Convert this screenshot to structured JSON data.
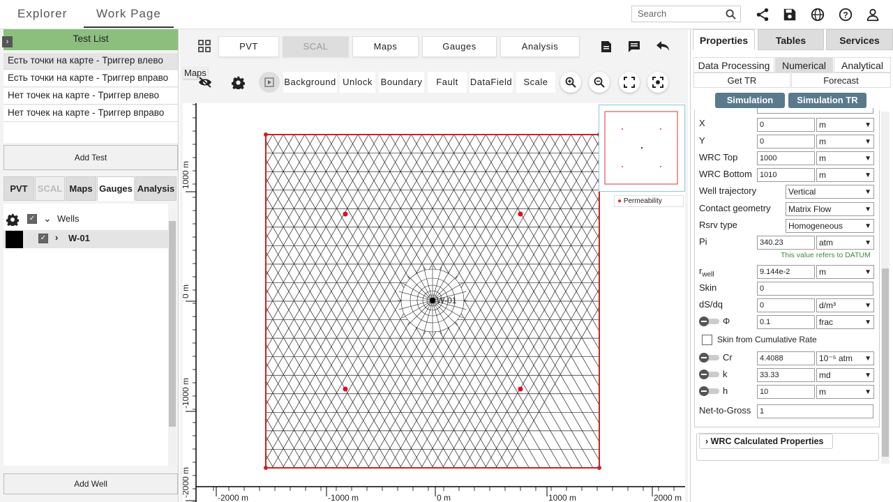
{
  "top": {
    "tabs": [
      "Explorer",
      "Work Page"
    ],
    "search_placeholder": "Search",
    "icons": [
      "share-icon",
      "save-icon",
      "globe-icon",
      "help-icon",
      "user-icon"
    ]
  },
  "left": {
    "test_list_title": "Test List",
    "tests": [
      "Есть точки на карте - Триггер влево",
      "Есть точки на карте - Триггер вправо",
      "Нет точек на карте - Триггер влево",
      "Нет точек на карте - Триггер вправо"
    ],
    "add_test": "Add Test",
    "tabs": [
      "PVT",
      "SCAL",
      "Maps",
      "Gauges",
      "Analysis"
    ],
    "wells_label": "Wells",
    "well_name": "W-01",
    "add_well": "Add Well"
  },
  "center": {
    "top_buttons": [
      "PVT",
      "SCAL",
      "Maps",
      "Gauges",
      "Analysis"
    ],
    "maps_label": "Maps",
    "tools": [
      "Background",
      "Unlock",
      "Boundary",
      "Fault",
      "DataField",
      "Scale"
    ],
    "well_label": "W-01",
    "legend": "Permeability",
    "x_ticks": [
      "-2000 m",
      "-1000 m",
      "0 m",
      "1000 m",
      "2000 m"
    ],
    "y_ticks": [
      "1000 m",
      "0 m",
      "-1000 m",
      "-2000 m"
    ]
  },
  "right": {
    "tabs": [
      "Properties",
      "Tables",
      "Services"
    ],
    "sub_tabs": [
      "Data Processing",
      "Numerical",
      "Analytical"
    ],
    "sub_tabs2": [
      "Get TR",
      "Forecast"
    ],
    "sim_buttons": [
      "Simulation",
      "Simulation TR"
    ],
    "props": {
      "x": {
        "label": "X",
        "value": "0",
        "unit": "m"
      },
      "y": {
        "label": "Y",
        "value": "0",
        "unit": "m"
      },
      "wrc_top": {
        "label": "WRC Top",
        "value": "1000",
        "unit": "m"
      },
      "wrc_bottom": {
        "label": "WRC Bottom",
        "value": "1010",
        "unit": "m"
      },
      "trajectory": {
        "label": "Well trajectory",
        "value": "Vertical"
      },
      "contact": {
        "label": "Contact geometry",
        "value": "Matrix Flow"
      },
      "rsrv": {
        "label": "Rsrv type",
        "value": "Homogeneous"
      },
      "pi": {
        "label": "Pi",
        "value": "340.23",
        "unit": "atm"
      },
      "pi_note": "This value refers to DATUM",
      "rwell": {
        "label": "r",
        "sub": "well",
        "value": "9.144e-2",
        "unit": "m"
      },
      "skin": {
        "label": "Skin",
        "value": "0"
      },
      "dsdq": {
        "label": "dS/dq",
        "value": "0",
        "unit": "d/m³"
      },
      "phi": {
        "label": "Φ",
        "value": "0.1",
        "unit": "frac"
      },
      "skin_cum": "Skin from Cumulative Rate",
      "cr": {
        "label": "Cr",
        "value": "4.4088",
        "unit": "10⁻⁵ atm"
      },
      "k": {
        "label": "k",
        "value": "33.33",
        "unit": "md"
      },
      "h": {
        "label": "h",
        "value": "10",
        "unit": "m"
      },
      "ntg": {
        "label": "Net-to-Gross",
        "value": "1"
      }
    },
    "wrc_calc": "WRC Calculated Properties"
  }
}
